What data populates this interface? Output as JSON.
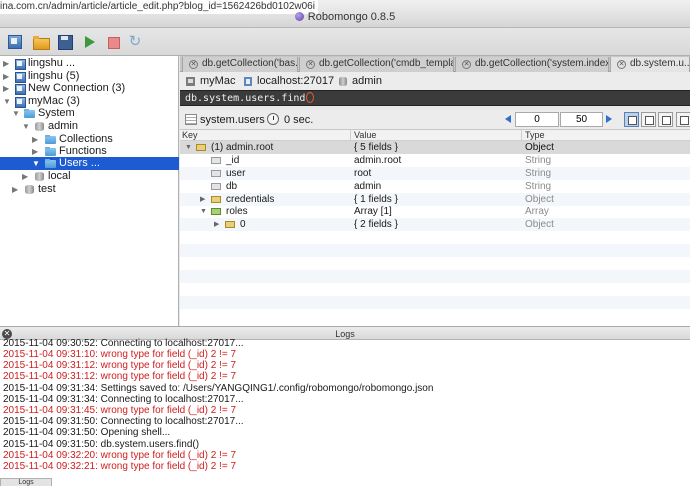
{
  "window": {
    "title": "Robomongo 0.8.5",
    "url_fragment": "ina.com.cn/admin/article/article_edit.php?blog_id=1562426bd0102w06i"
  },
  "toolbar": {
    "buttons": [
      {
        "name": "connect",
        "icon": "connect-icon"
      },
      {
        "name": "open",
        "icon": "folder-open-icon"
      },
      {
        "name": "save",
        "icon": "save-icon"
      },
      {
        "name": "execute",
        "icon": "play-icon"
      },
      {
        "name": "stop",
        "icon": "stop-icon"
      },
      {
        "name": "refresh",
        "icon": "refresh-icon"
      }
    ]
  },
  "tree": {
    "items": [
      {
        "label": "lingshu ...",
        "icon": "server-icon",
        "expanded": false
      },
      {
        "label": "lingshu (5)",
        "icon": "server-icon",
        "expanded": false
      },
      {
        "label": "New Connection (3)",
        "icon": "server-icon",
        "expanded": false
      },
      {
        "label": "myMac (3)",
        "icon": "server-icon",
        "expanded": true
      },
      {
        "label": "System",
        "icon": "folder-icon",
        "expanded": true
      },
      {
        "label": "admin",
        "icon": "database-icon",
        "expanded": true
      },
      {
        "label": "Collections",
        "icon": "folder-icon",
        "expanded": false
      },
      {
        "label": "Functions",
        "icon": "folder-icon",
        "expanded": false
      },
      {
        "label": "Users ...",
        "icon": "folder-icon",
        "expanded": true,
        "selected": true
      },
      {
        "label": "local",
        "icon": "database-icon",
        "expanded": false
      },
      {
        "label": "test",
        "icon": "database-icon",
        "expanded": false
      }
    ]
  },
  "tabs": [
    {
      "label": "db.getCollection('bas..."
    },
    {
      "label": "db.getCollection('cmdb_templat..."
    },
    {
      "label": "db.getCollection('system.index..."
    },
    {
      "label": "db.system.u...",
      "active": true
    }
  ],
  "query_info": {
    "connection": "myMac",
    "server": "localhost:27017",
    "database": "admin"
  },
  "editor": {
    "query": "db.system.users.find"
  },
  "results": {
    "collection": "system.users",
    "time": "0 sec.",
    "skip": "0",
    "limit": "50",
    "columns": [
      "Key",
      "Value",
      "Type"
    ],
    "rows": [
      {
        "key": "(1) admin.root",
        "value": "{ 5 fields }",
        "type": "Object",
        "icon": "object-icon"
      },
      {
        "key": "_id",
        "value": "admin.root",
        "type": "String",
        "icon": "value-icon"
      },
      {
        "key": "user",
        "value": "root",
        "type": "String",
        "icon": "value-icon"
      },
      {
        "key": "db",
        "value": "admin",
        "type": "String",
        "icon": "value-icon"
      },
      {
        "key": "credentials",
        "value": "{ 1 fields }",
        "type": "Object",
        "icon": "object-icon"
      },
      {
        "key": "roles",
        "value": "Array [1]",
        "type": "Array",
        "icon": "array-icon"
      },
      {
        "key": "0",
        "value": "{ 2 fields }",
        "type": "Object",
        "icon": "object-icon"
      }
    ]
  },
  "logs": {
    "title": "Logs",
    "bottom_tab": "Logs",
    "lines": [
      {
        "text": "2015-11-04 09:30:52: Connecting to localhost:27017...",
        "error": false
      },
      {
        "text": "2015-11-04 09:31:10: wrong type for field (_id) 2 != 7",
        "error": true
      },
      {
        "text": "2015-11-04 09:31:12: wrong type for field (_id) 2 != 7",
        "error": true
      },
      {
        "text": "2015-11-04 09:31:12: wrong type for field (_id) 2 != 7",
        "error": true
      },
      {
        "text": "2015-11-04 09:31:34: Settings saved to: /Users/YANGQING1/.config/robomongo/robomongo.json",
        "error": false
      },
      {
        "text": "2015-11-04 09:31:34: Connecting to localhost:27017...",
        "error": false
      },
      {
        "text": "2015-11-04 09:31:45: wrong type for field (_id) 2 != 7",
        "error": true
      },
      {
        "text": "2015-11-04 09:31:50: Connecting to localhost:27017...",
        "error": false
      },
      {
        "text": "2015-11-04 09:31:50: Opening shell...",
        "error": false
      },
      {
        "text": "2015-11-04 09:31:50: db.system.users.find()",
        "error": false
      },
      {
        "text": "2015-11-04 09:32:20: wrong type for field (_id) 2 != 7",
        "error": true
      },
      {
        "text": "2015-11-04 09:32:21: wrong type for field (_id) 2 != 7",
        "error": true
      }
    ]
  },
  "colors": {
    "selection": "#1d5bd3",
    "error_text": "#cf1d1d",
    "editor_bg": "#3b3b3b"
  }
}
